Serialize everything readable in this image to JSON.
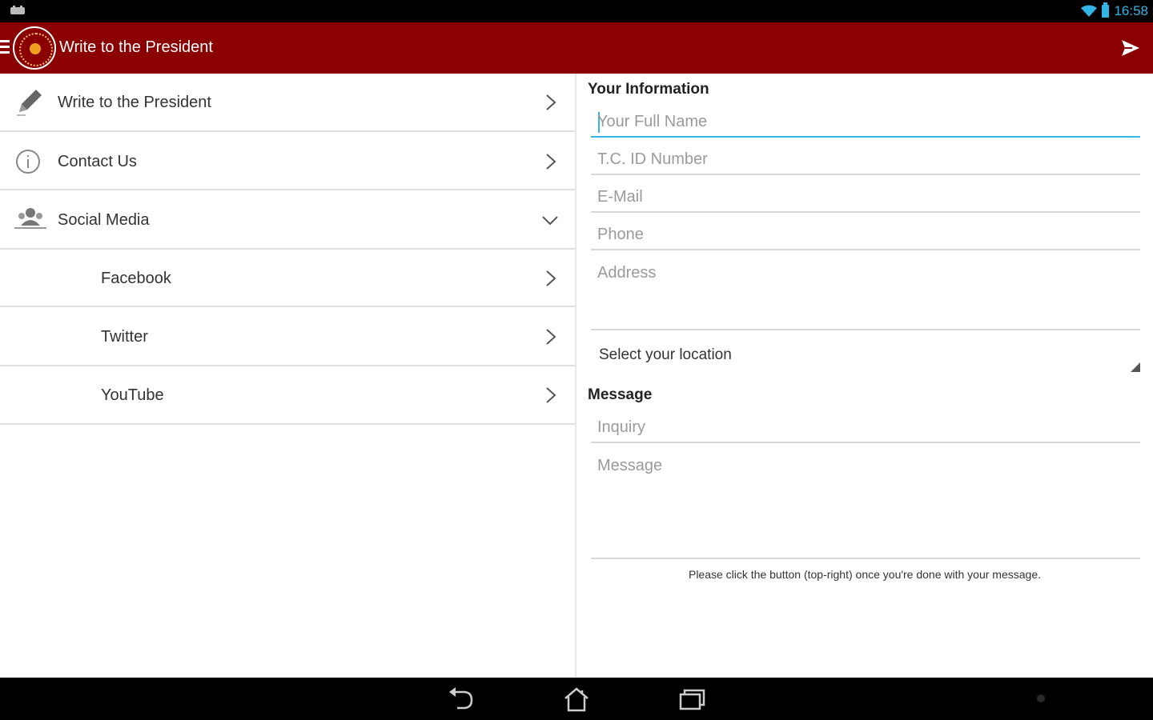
{
  "status_bar": {
    "time": "16:58"
  },
  "action_bar": {
    "title": "Write to the President",
    "send_icon": "send-icon",
    "menu_icon": "menu-icon"
  },
  "nav_list": {
    "items": [
      {
        "label": "Write to the President",
        "icon": "pencil-icon",
        "indicator": "chevron-right"
      },
      {
        "label": "Contact Us",
        "icon": "info-icon",
        "indicator": "chevron-right"
      },
      {
        "label": "Social Media",
        "icon": "people-icon",
        "indicator": "chevron-down"
      },
      {
        "label": "Facebook",
        "indicator": "chevron-right"
      },
      {
        "label": "Twitter",
        "indicator": "chevron-right"
      },
      {
        "label": "YouTube",
        "indicator": "chevron-right"
      }
    ]
  },
  "form": {
    "your_information_title": "Your Information",
    "full_name": {
      "value": "",
      "placeholder": "Your Full Name"
    },
    "tc_id": {
      "value": "",
      "placeholder": "T.C. ID Number"
    },
    "email": {
      "value": "",
      "placeholder": "E-Mail"
    },
    "phone": {
      "value": "",
      "placeholder": "Phone"
    },
    "address": {
      "value": "",
      "placeholder": "Address"
    },
    "location_select": {
      "selected": "Select your location"
    },
    "message_title": "Message",
    "inquiry": {
      "value": "",
      "placeholder": "Inquiry"
    },
    "message": {
      "value": "",
      "placeholder": "Message"
    },
    "hint": "Please click the button (top-right) once you're done with your message."
  },
  "colors": {
    "action_bar": "#8b0000",
    "accent": "#33b5e5"
  }
}
